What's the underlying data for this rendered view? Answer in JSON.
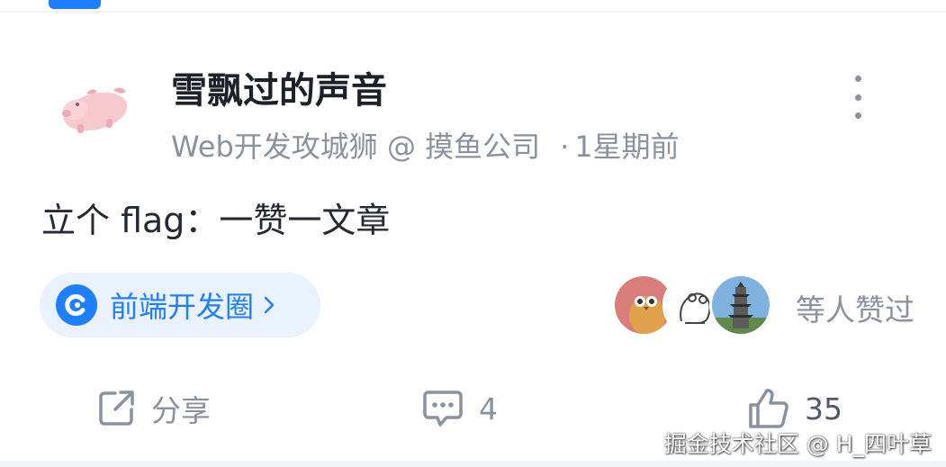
{
  "post": {
    "author_name": "雪飘过的声音",
    "author_title": "Web开发攻城狮 @ 摸鱼公司",
    "time_separator": "·",
    "posted_time": "1星期前",
    "content": "立个 flag：一赞一文章"
  },
  "circle": {
    "name": "前端开发圈",
    "icon": "juejin-circle-icon"
  },
  "likes": {
    "liked_by_text": "等人赞过",
    "avatars": [
      "owl-avatar",
      "frog-sketch-avatar",
      "pagoda-avatar"
    ]
  },
  "actions": {
    "share_label": "分享",
    "comment_count": "4",
    "like_count": "35"
  },
  "watermark": "掘金技术社区 @ H_四叶草",
  "colors": {
    "accent": "#1e80ff",
    "circle_bg": "#eaf2ff",
    "secondary_text": "#8a919f",
    "primary_text": "#1d2129"
  }
}
